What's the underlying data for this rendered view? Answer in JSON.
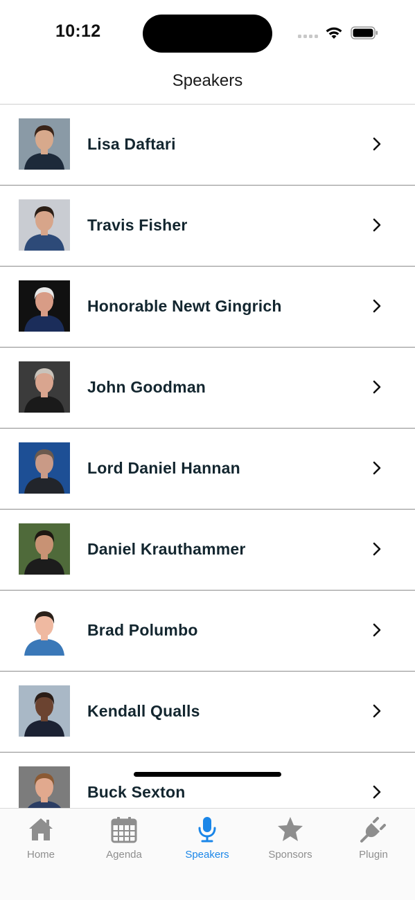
{
  "status_bar": {
    "time": "10:12",
    "icons": [
      "cellular-signal-icon",
      "wifi-icon",
      "battery-icon"
    ]
  },
  "header": {
    "title": "Speakers"
  },
  "speakers": [
    {
      "name": "Lisa Daftari",
      "photo_bg": "#8a9aa6",
      "skin": "#d7a98c",
      "hair": "#3a2418",
      "clothes": "#1d2a3a"
    },
    {
      "name": "Travis Fisher",
      "photo_bg": "#c9ccd2",
      "skin": "#d7a58a",
      "hair": "#2b1e16",
      "clothes": "#2d4a78"
    },
    {
      "name": "Honorable Newt Gingrich",
      "photo_bg": "#111111",
      "skin": "#d89c86",
      "hair": "#e8e8e8",
      "clothes": "#1b2d5a"
    },
    {
      "name": "John Goodman",
      "photo_bg": "#3b3b3b",
      "skin": "#d9a58f",
      "hair": "#c9c3bb",
      "clothes": "#1a1a1a"
    },
    {
      "name": "Lord Daniel Hannan",
      "photo_bg": "#1d4f95",
      "skin": "#c99a86",
      "hair": "#6b5a4e",
      "clothes": "#22252b"
    },
    {
      "name": "Daniel Krauthammer",
      "photo_bg": "#4f6a3a",
      "skin": "#c89274",
      "hair": "#1e1812",
      "clothes": "#1c1c1c"
    },
    {
      "name": "Brad Polumbo",
      "photo_bg": "#ffffff",
      "skin": "#efb9a1",
      "hair": "#2a2019",
      "clothes": "#3a78b8"
    },
    {
      "name": "Kendall Qualls",
      "photo_bg": "#a9b8c6",
      "skin": "#6b4330",
      "hair": "#2a1d17",
      "clothes": "#1c2233"
    },
    {
      "name": "Buck Sexton",
      "photo_bg": "#7c7c7c",
      "skin": "#e1a98e",
      "hair": "#8b5a34",
      "clothes": "#2b3d63"
    }
  ],
  "tabs": [
    {
      "label": "Home",
      "icon": "house-icon",
      "active": false
    },
    {
      "label": "Agenda",
      "icon": "calendar-icon",
      "active": false
    },
    {
      "label": "Speakers",
      "icon": "microphone-icon",
      "active": true
    },
    {
      "label": "Sponsors",
      "icon": "star-icon",
      "active": false
    },
    {
      "label": "Plugin",
      "icon": "plug-icon",
      "active": false
    }
  ],
  "colors": {
    "accent": "#1a86e8",
    "inactive_tab": "#8e8e8e",
    "name_text": "#13262f"
  }
}
